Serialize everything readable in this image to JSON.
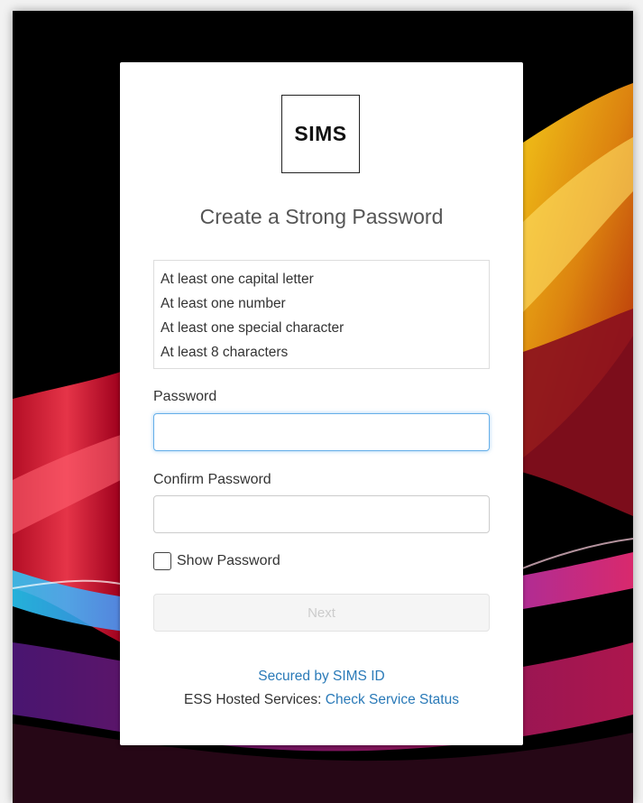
{
  "logo": {
    "text": "SIMS"
  },
  "title": "Create a Strong Password",
  "requirements": [
    "At least one capital letter",
    "At least one number",
    "At least one special character",
    "At least 8 characters"
  ],
  "password": {
    "label": "Password",
    "value": ""
  },
  "confirm": {
    "label": "Confirm Password",
    "value": ""
  },
  "show_password": {
    "label": "Show Password",
    "checked": false
  },
  "next_button": {
    "label": "Next",
    "enabled": false
  },
  "footer": {
    "secured_link": "Secured by SIMS ID",
    "service_prefix": "ESS Hosted Services: ",
    "service_link": "Check Service Status"
  },
  "colors": {
    "link": "#2a7ab8",
    "focus_border": "#66afe9",
    "background": "#000000"
  }
}
